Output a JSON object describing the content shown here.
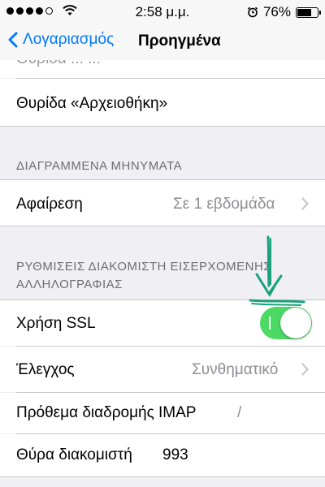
{
  "status_bar": {
    "signal_dots": [
      true,
      true,
      true,
      true,
      false
    ],
    "time": "2:58 μ.μ.",
    "battery_percent": "76%",
    "battery_level": 0.76
  },
  "nav": {
    "back_label": "Λογαριασμός",
    "title": "Προηγμένα"
  },
  "rows": {
    "partial_top": "Θυρίδα ... ...",
    "archive_mailbox": "Θυρίδα «Αρχειοθήκη»",
    "remove_label": "Αφαίρεση",
    "remove_value": "Σε 1 εβδομάδα",
    "ssl_label": "Χρήση SSL",
    "ssl_on": true,
    "auth_label": "Έλεγχος",
    "auth_value": "Συνθηματικό",
    "imap_prefix_label": "Πρόθεμα διαδρομής IMAP",
    "imap_prefix_value": "/",
    "server_port_label": "Θύρα διακομιστή",
    "server_port_value": "993"
  },
  "sections": {
    "deleted_header": "ΔΙΑΓΡΑΜΜΕΝΑ ΜΗΝΥΜΑΤΑ",
    "incoming_header_line1": "ΡΥΘΜΙΣΕΙΣ ΔΙΑΚΟΜΙΣΤΗ ΕΙΣΕΡΧΟΜΕΝΗΣ",
    "incoming_header_line2": "ΑΛΛΗΛΟΓΡΑΦΙΑΣ"
  },
  "colors": {
    "accent": "#007aff",
    "toggle_on": "#4cd964",
    "annotation_arrow": "#1aa37a"
  },
  "icons": [
    "wifi-icon",
    "alarm-icon",
    "battery-icon",
    "chevron-left-icon",
    "chevron-right-icon",
    "hand-drawn-arrow"
  ]
}
